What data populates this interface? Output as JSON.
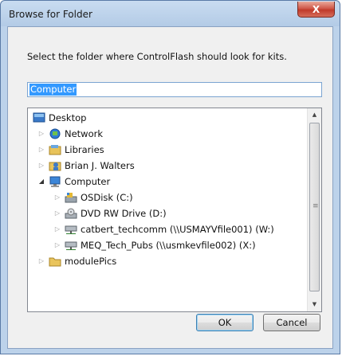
{
  "window": {
    "title": "Browse for Folder",
    "close_glyph": "X"
  },
  "dialog": {
    "prompt": "Select the folder where ControlFlash should look for kits.",
    "folder_field_value": "Computer",
    "ok_label": "OK",
    "cancel_label": "Cancel"
  },
  "tree": {
    "items": [
      {
        "label": "Desktop",
        "icon": "desktop-icon",
        "expander": "none",
        "level": 0
      },
      {
        "label": "Network",
        "icon": "network-icon",
        "expander": "collapsed",
        "level": 1
      },
      {
        "label": "Libraries",
        "icon": "libraries-icon",
        "expander": "collapsed",
        "level": 1
      },
      {
        "label": "Brian J. Walters",
        "icon": "user-folder-icon",
        "expander": "collapsed",
        "level": 1
      },
      {
        "label": "Computer",
        "icon": "computer-icon",
        "expander": "expanded",
        "level": 1,
        "selected": true
      },
      {
        "label": "OSDisk (C:)",
        "icon": "hard-drive-icon",
        "expander": "collapsed",
        "level": 2
      },
      {
        "label": "DVD RW Drive (D:)",
        "icon": "dvd-drive-icon",
        "expander": "collapsed",
        "level": 2
      },
      {
        "label": "catbert_techcomm (\\\\USMAYVfile001) (W:)",
        "icon": "network-drive-icon",
        "expander": "collapsed",
        "level": 2
      },
      {
        "label": "MEQ_Tech_Pubs (\\\\usmkevfile002) (X:)",
        "icon": "network-drive-icon",
        "expander": "collapsed",
        "level": 2
      },
      {
        "label": "modulePics",
        "icon": "folder-icon",
        "expander": "collapsed",
        "level": 1
      }
    ]
  }
}
